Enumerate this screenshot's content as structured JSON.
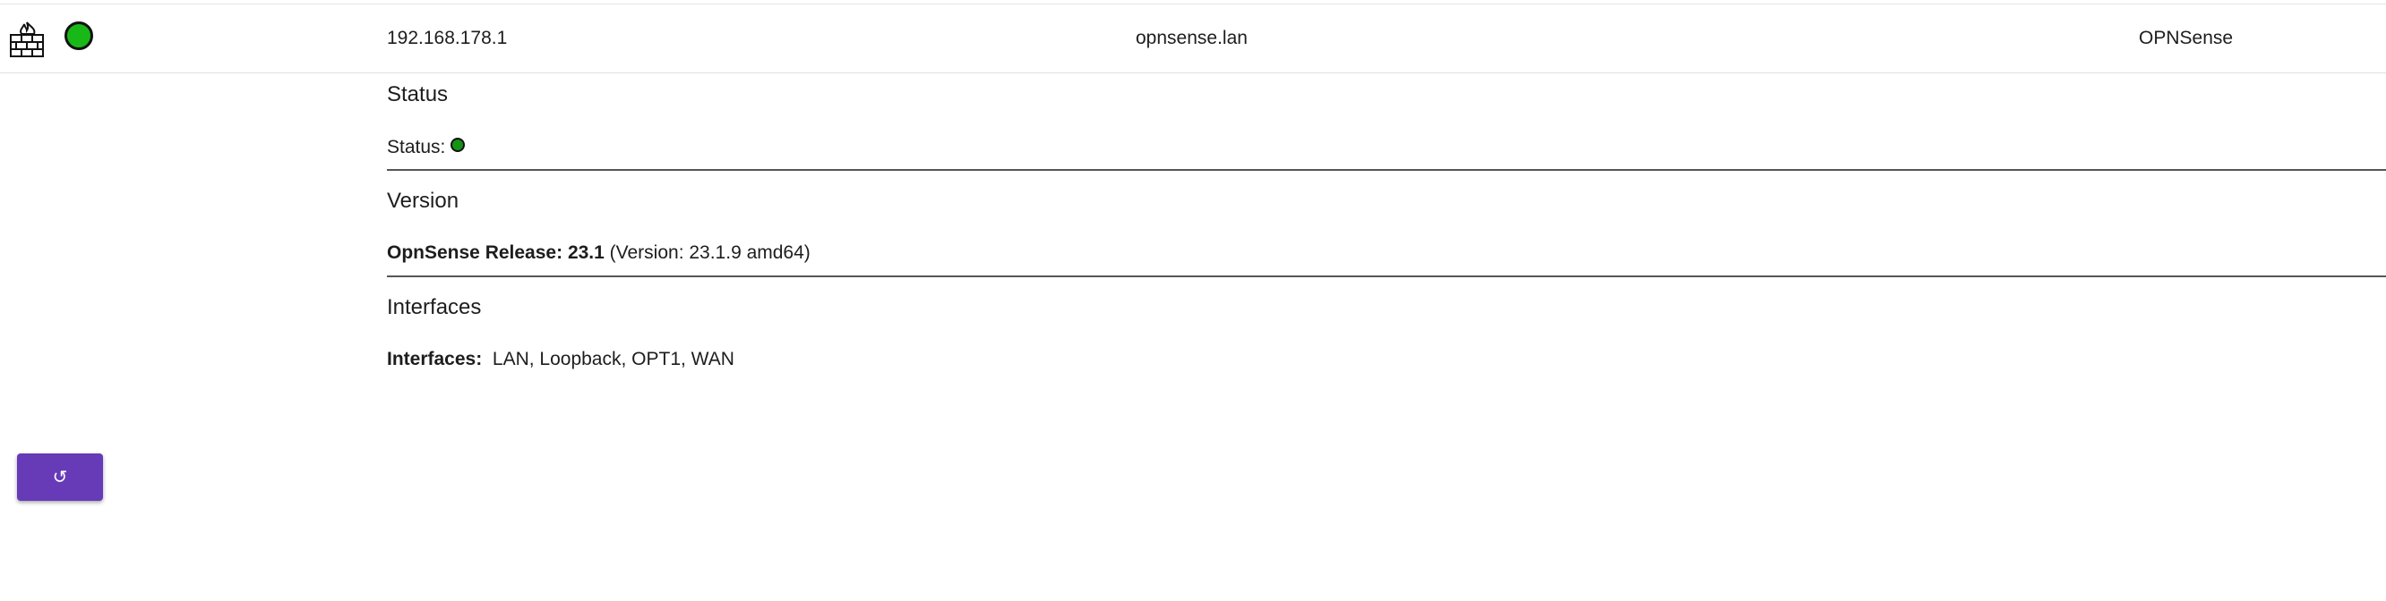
{
  "row": {
    "firewall_icon": "firewall-icon",
    "status_color": "#18b818",
    "ip": "192.168.178.1",
    "hostname": "opnsense.lan",
    "name": "OPNSense"
  },
  "sections": {
    "status": {
      "title": "Status",
      "label": "Status:",
      "status_color": "#149414"
    },
    "version": {
      "title": "Version",
      "release_label": "OpnSense Release:",
      "release_value": "23.1",
      "version_detail": "(Version: 23.1.9 amd64)"
    },
    "interfaces": {
      "title": "Interfaces",
      "label": "Interfaces:",
      "value": "LAN, Loopback, OPT1, WAN"
    }
  },
  "reload_button": {
    "icon": "refresh-icon",
    "glyph": "↺",
    "color": "#673ab7"
  }
}
